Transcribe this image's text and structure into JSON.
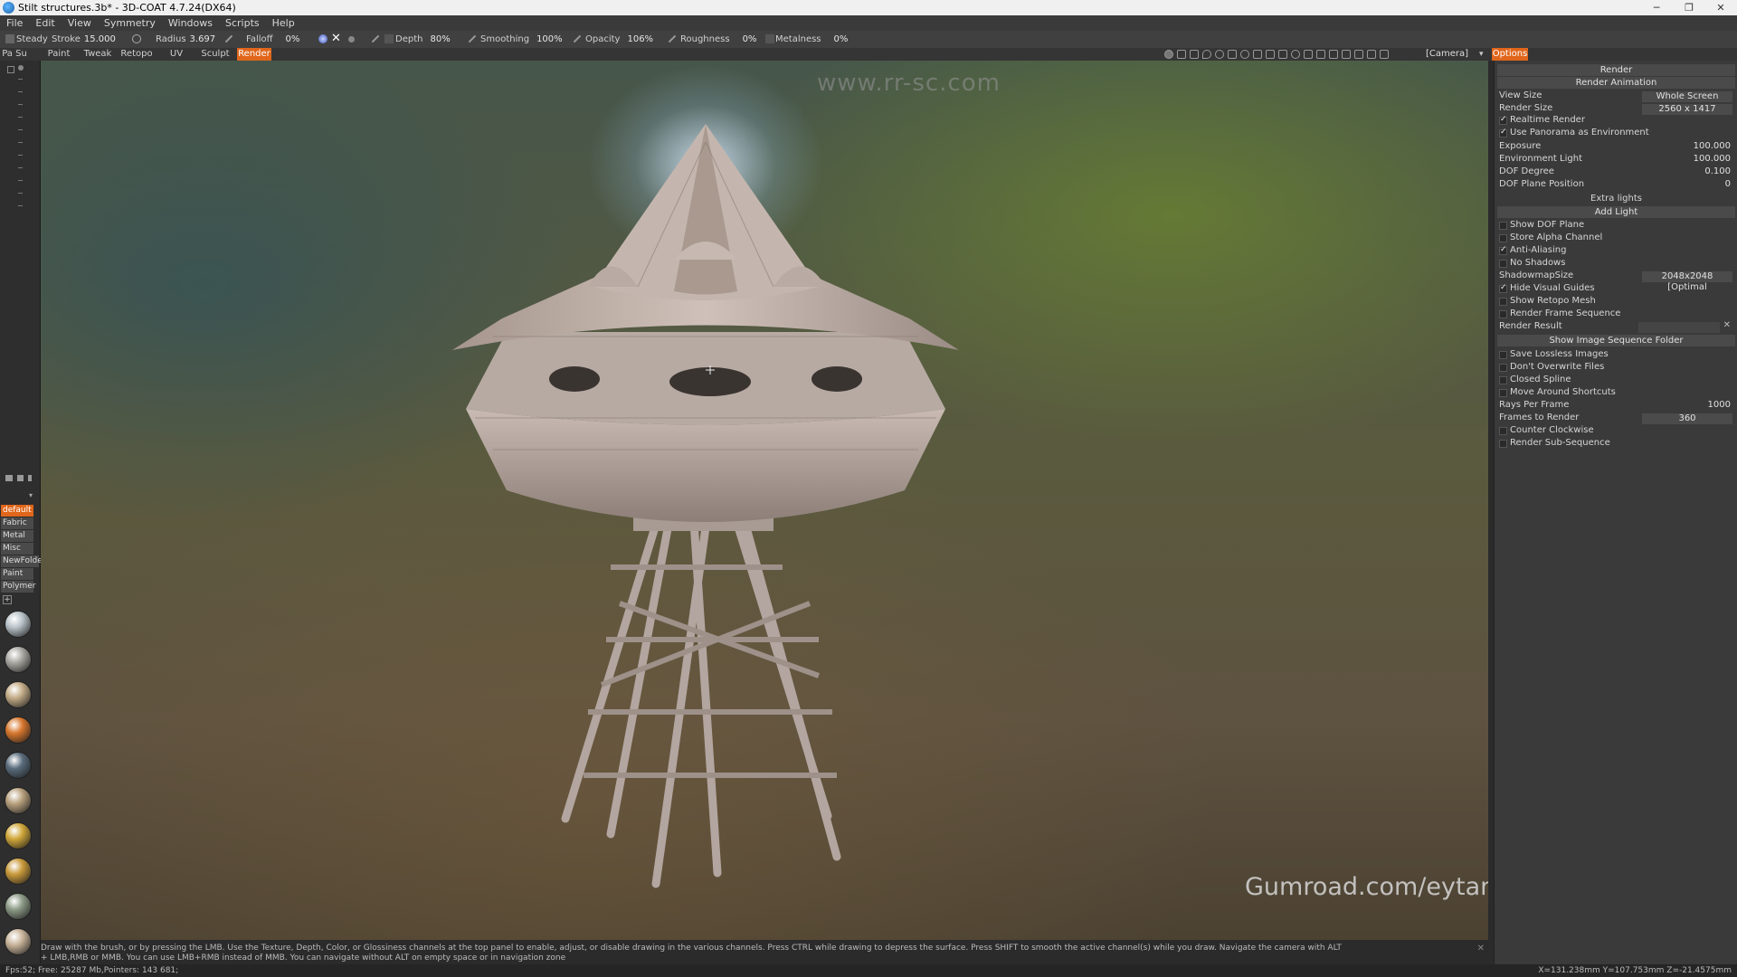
{
  "window": {
    "title": "Stilt structures.3b* - 3D-COAT 4.7.24(DX64)",
    "controls": [
      "─",
      "❐",
      "✕"
    ]
  },
  "menu": [
    "File",
    "Edit",
    "View",
    "Symmetry",
    "Windows",
    "Scripts",
    "Help"
  ],
  "watermark": "www.rr-sc.com",
  "toolbar": {
    "steady": "Steady",
    "stroke_label": "Stroke",
    "stroke_value": "15.000",
    "radius_label": "Radius",
    "radius_value": "3.697",
    "falloff_label": "Falloff",
    "falloff_value": "0%",
    "depth_label": "Depth",
    "depth_value": "80%",
    "smoothing_label": "Smoothing",
    "smoothing_value": "100%",
    "opacity_label": "Opacity",
    "opacity_value": "106%",
    "roughness_label": "Roughness",
    "roughness_value": "0%",
    "metalness_label": "Metalness",
    "metalness_value": "0%"
  },
  "tabs": [
    "Pa Su",
    "Paint",
    "Tweak",
    "Retopo",
    "UV",
    "Sculpt",
    "Render"
  ],
  "active_tab": "Render",
  "camera_label": "[Camera]",
  "options_label": "Options",
  "materials": {
    "categories": [
      "default",
      "Fabric",
      "Metal",
      "Misc",
      "NewFolder",
      "Paint",
      "Polymer"
    ],
    "active": "default",
    "swatches": [
      "#b9c3c9",
      "#aaa8a2",
      "#c4ad88",
      "#d8772e",
      "#5a6c7c",
      "#b8a17e",
      "#d0a73a",
      "#c99a3a",
      "#8c9a86",
      "#c9b49a"
    ]
  },
  "branding": "Gumroad.com/eytanzana",
  "render_panel": {
    "header": "Render",
    "render_animation": "Render Animation",
    "view_size_label": "View Size",
    "view_size_value": "Whole Screen",
    "render_size_label": "Render Size",
    "render_size_value": "2560 x 1417",
    "realtime_render": "Realtime Render",
    "use_panorama": "Use Panorama as Environment",
    "exposure_label": "Exposure",
    "exposure_value": "100.000",
    "env_light_label": "Environment Light",
    "env_light_value": "100.000",
    "dof_degree_label": "DOF Degree",
    "dof_degree_value": "0.100",
    "dof_plane_label": "DOF Plane Position",
    "dof_plane_value": "0",
    "extra_lights": "Extra lights",
    "add_light": "Add Light",
    "show_dof_plane": "Show DOF Plane",
    "store_alpha": "Store Alpha Channel",
    "anti_aliasing": "Anti-Aliasing",
    "no_shadows": "No Shadows",
    "shadowmap_label": "ShadowmapSize",
    "shadowmap_value": "2048x2048 [Optimal",
    "hide_visual_guides": "Hide Visual Guides",
    "show_retopo_mesh": "Show Retopo Mesh",
    "render_frame_sequence": "Render Frame Sequence",
    "render_result_label": "Render Result",
    "show_image_seq_folder": "Show Image Sequence Folder",
    "save_lossless": "Save Lossless Images",
    "dont_overwrite": "Don't Overwrite Files",
    "closed_spline": "Closed Spline",
    "move_around_shortcuts": "Move Around Shortcuts",
    "rays_label": "Rays Per Frame",
    "rays_value": "1000",
    "frames_label": "Frames to Render",
    "frames_value": "360",
    "counter_clockwise": "Counter Clockwise",
    "render_sub_sequence": "Render Sub-Sequence"
  },
  "hint": {
    "line1": "Draw with the brush, or by pressing the LMB. Use the Texture, Depth, Color, or Glossiness channels at the top panel to enable, adjust, or disable drawing in the various channels. Press CTRL while drawing to depress the surface. Press SHIFT to smooth the active channel(s) while you draw. Navigate the camera with ALT",
    "line2": "+ LMB,RMB or MMB. You can use LMB+RMB instead of MMB. You can navigate without ALT on empty space or in navigation zone"
  },
  "status": {
    "left": "Fps:52;    Free: 25287 Mb,Pointers: 143 681;",
    "right": "X=131.238mm  Y=107.753mm  Z=-21.4575mm"
  }
}
